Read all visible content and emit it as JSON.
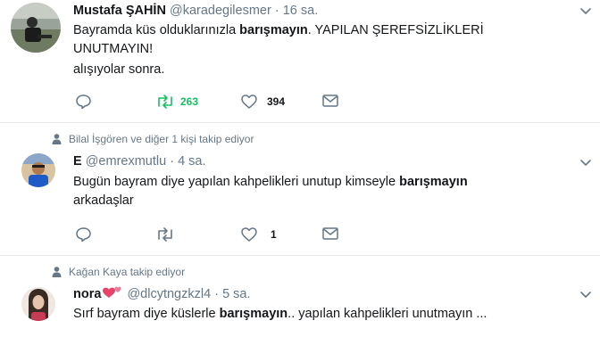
{
  "tweets": [
    {
      "context": null,
      "name": "Mustafa ŞAHİN",
      "handle": "@karadegilesmer",
      "sep": "·",
      "time": "16 sa.",
      "line1_pre": "Bayramda küs olduklarınızla ",
      "line1_kw": "barışmayın",
      "line1_post": ". YAPILAN ŞEREFSİZLİKLERİ",
      "line2": "UNUTMAYIN!",
      "line3": "alışıyolar sonra.",
      "reply_count": "",
      "retweet_count": "263",
      "like_count": "394"
    },
    {
      "context": "Bilal İşgören ve diğer 1 kişi takip ediyor",
      "name": "E",
      "handle": "@emrexmutlu",
      "sep": "·",
      "time": "4 sa.",
      "line1_pre": "Bugün bayram diye yapılan kahpelikleri unutup kimseyle ",
      "line1_kw": "barışmayın",
      "line2": "arkadaşlar",
      "reply_count": "",
      "retweet_count": "",
      "like_count": "1"
    },
    {
      "context": "Kağan Kaya takip ediyor",
      "name": "nora",
      "handle": "@dlcytngzkzl4",
      "sep": "·",
      "time": "5 sa.",
      "line1_pre": "Sırf bayram diye küslerle ",
      "line1_kw": "barışmayın",
      "line1_post": ".. yapılan kahpelikleri unutmayın ..."
    }
  ],
  "colors": {
    "text": "#14171a",
    "secondary": "#657786",
    "retweet_active": "#17bf63",
    "divider": "#e6ecf0"
  },
  "icons": {
    "reply": "speech-bubble-icon",
    "retweet": "retweet-arrows-icon",
    "like": "heart-outline-icon",
    "dm": "envelope-icon",
    "more": "chevron-down-icon",
    "context": "person-icon"
  }
}
